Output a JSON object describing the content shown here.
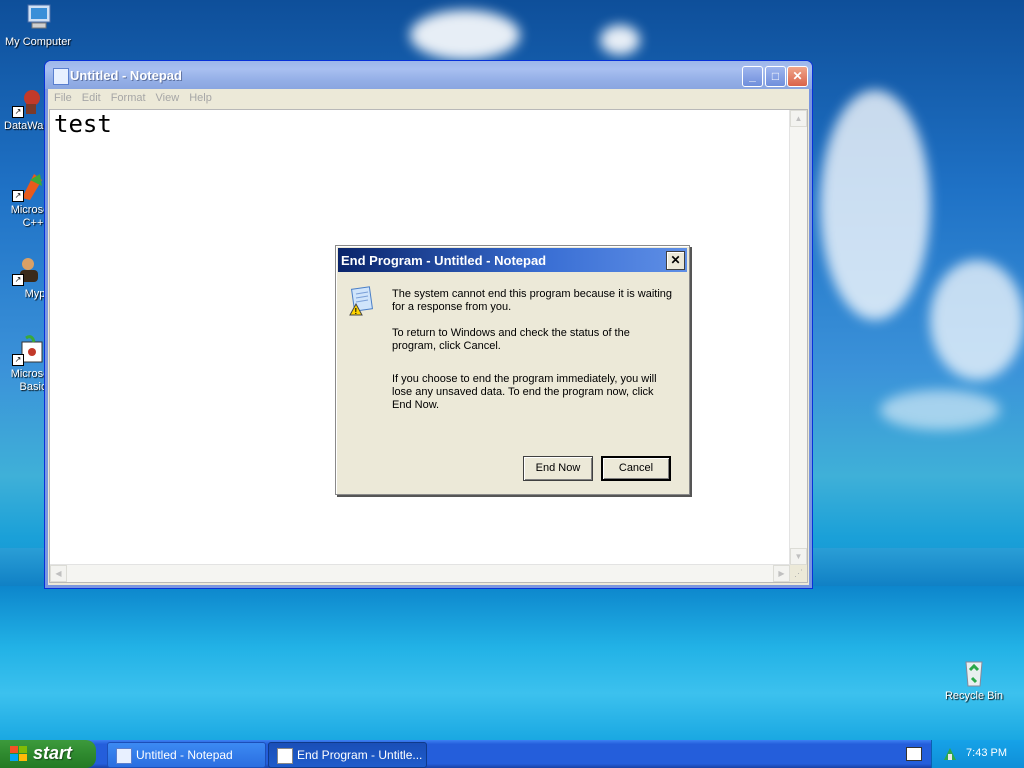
{
  "desktop": {
    "icons": [
      {
        "label": "My Computer"
      },
      {
        "label": "DataWar"
      },
      {
        "label": "Microsoft C++"
      },
      {
        "label": "Myp"
      },
      {
        "label": "Microsoft Basic"
      },
      {
        "label": "Recycle Bin"
      }
    ]
  },
  "notepad": {
    "title": "Untitled - Notepad",
    "menu": [
      "File",
      "Edit",
      "Format",
      "View",
      "Help"
    ],
    "content": "test",
    "buttons": {
      "minimize": "_",
      "maximize": "□",
      "close": "✕"
    }
  },
  "dialog": {
    "title": "End Program - Untitled - Notepad",
    "close": "✕",
    "paragraph1": "The system cannot end this program because it is waiting for a response from you.",
    "paragraph2": "To return to Windows and check the status of the program, click Cancel.",
    "paragraph3": "If you choose to end the program immediately, you will lose any unsaved data. To end the program now, click End Now.",
    "end_now": "End Now",
    "cancel": "Cancel"
  },
  "taskbar": {
    "start": "start",
    "tasks": [
      {
        "label": "Untitled - Notepad"
      },
      {
        "label": "End Program - Untitle..."
      }
    ],
    "clock": "7:43 PM"
  },
  "colors": {
    "xp_blue": "#245edb",
    "start_green": "#2f8a2f",
    "dialog_title": "#0a246a"
  }
}
